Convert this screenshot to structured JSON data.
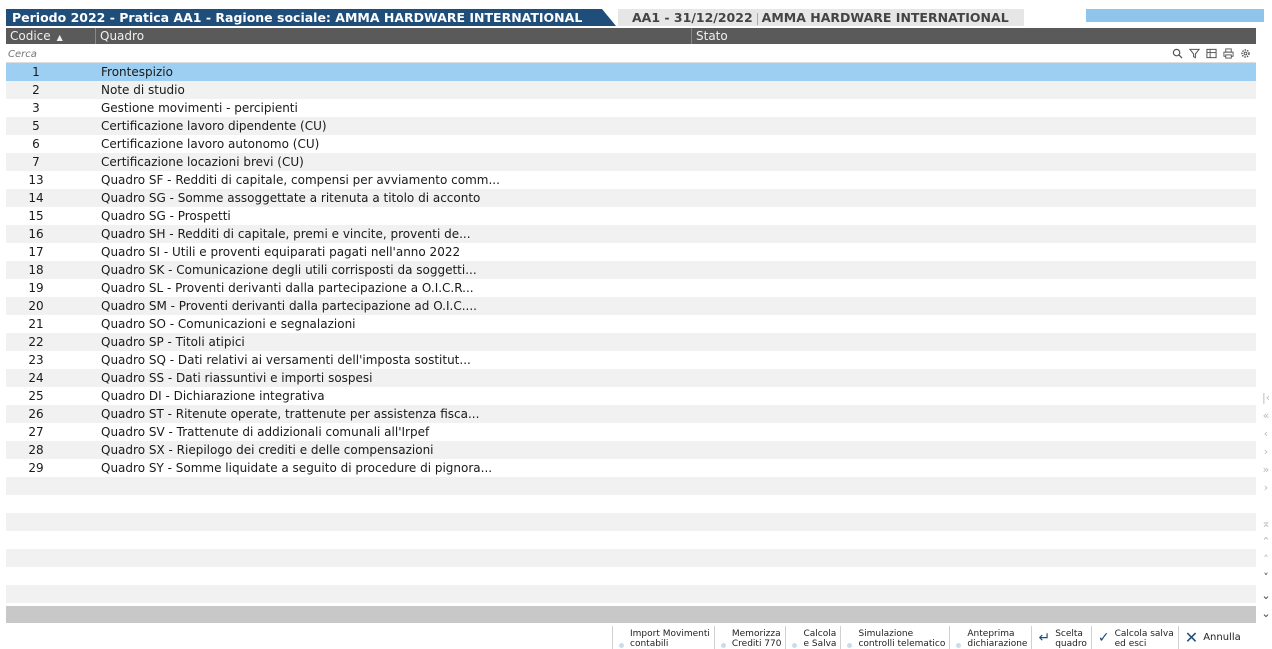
{
  "tabs": {
    "active": "Periodo 2022 - Pratica AA1 - Ragione sociale: AMMA HARDWARE INTERNATIONAL",
    "second_code": "AA1 - 31/12/2022",
    "second_name": "AMMA HARDWARE INTERNATIONAL"
  },
  "columns": {
    "code": "Codice",
    "sort_indicator": "▲",
    "quadro": "Quadro",
    "stato": "Stato"
  },
  "search": {
    "placeholder": "Cerca"
  },
  "rows": [
    {
      "code": "1",
      "name": "Frontespizio"
    },
    {
      "code": "2",
      "name": "Note di studio"
    },
    {
      "code": "3",
      "name": "Gestione movimenti - percipienti"
    },
    {
      "code": "5",
      "name": "Certificazione lavoro dipendente (CU)"
    },
    {
      "code": "6",
      "name": "Certificazione lavoro autonomo (CU)"
    },
    {
      "code": "7",
      "name": "Certificazione locazioni brevi (CU)"
    },
    {
      "code": "13",
      "name": "Quadro SF - Redditi di capitale, compensi per avviamento comm..."
    },
    {
      "code": "14",
      "name": "Quadro SG - Somme assoggettate a ritenuta a titolo di acconto"
    },
    {
      "code": "15",
      "name": "Quadro SG - Prospetti"
    },
    {
      "code": "16",
      "name": "Quadro SH - Redditi di capitale, premi e vincite, proventi de..."
    },
    {
      "code": "17",
      "name": "Quadro SI - Utili e proventi equiparati pagati nell'anno 2022"
    },
    {
      "code": "18",
      "name": "Quadro SK - Comunicazione degli utili corrisposti da soggetti..."
    },
    {
      "code": "19",
      "name": "Quadro SL - Proventi derivanti dalla partecipazione a O.I.C.R..."
    },
    {
      "code": "20",
      "name": "Quadro SM - Proventi derivanti dalla partecipazione ad O.I.C...."
    },
    {
      "code": "21",
      "name": "Quadro SO - Comunicazioni e segnalazioni"
    },
    {
      "code": "22",
      "name": "Quadro SP - Titoli atipici"
    },
    {
      "code": "23",
      "name": "Quadro SQ - Dati relativi ai versamenti dell'imposta sostitut..."
    },
    {
      "code": "24",
      "name": "Quadro SS - Dati riassuntivi e importi sospesi"
    },
    {
      "code": "25",
      "name": "Quadro DI - Dichiarazione integrativa"
    },
    {
      "code": "26",
      "name": "Quadro ST - Ritenute operate, trattenute per assistenza fisca..."
    },
    {
      "code": "27",
      "name": "Quadro SV - Trattenute di addizionali comunali all'Irpef"
    },
    {
      "code": "28",
      "name": "Quadro SX - Riepilogo dei crediti e delle compensazioni"
    },
    {
      "code": "29",
      "name": "Quadro SY - Somme liquidate a seguito di procedure di pignora..."
    }
  ],
  "selected_row_code": "1",
  "footer": {
    "import": "Import Movimenti\ncontabili",
    "memorizza": "Memorizza\nCrediti 770",
    "calcola": "Calcola\ne Salva",
    "simulazione": "Simulazione\ncontrolli telematico",
    "anteprima": "Anteprima\ndichiarazione",
    "scelta": "Scelta\nquadro",
    "calcola_salva": "Calcola salva\ned esci",
    "annulla": "Annulla"
  },
  "colors": {
    "accent": "#1f4e7a",
    "selection": "#9ccff2",
    "header": "#5a5a5a"
  }
}
